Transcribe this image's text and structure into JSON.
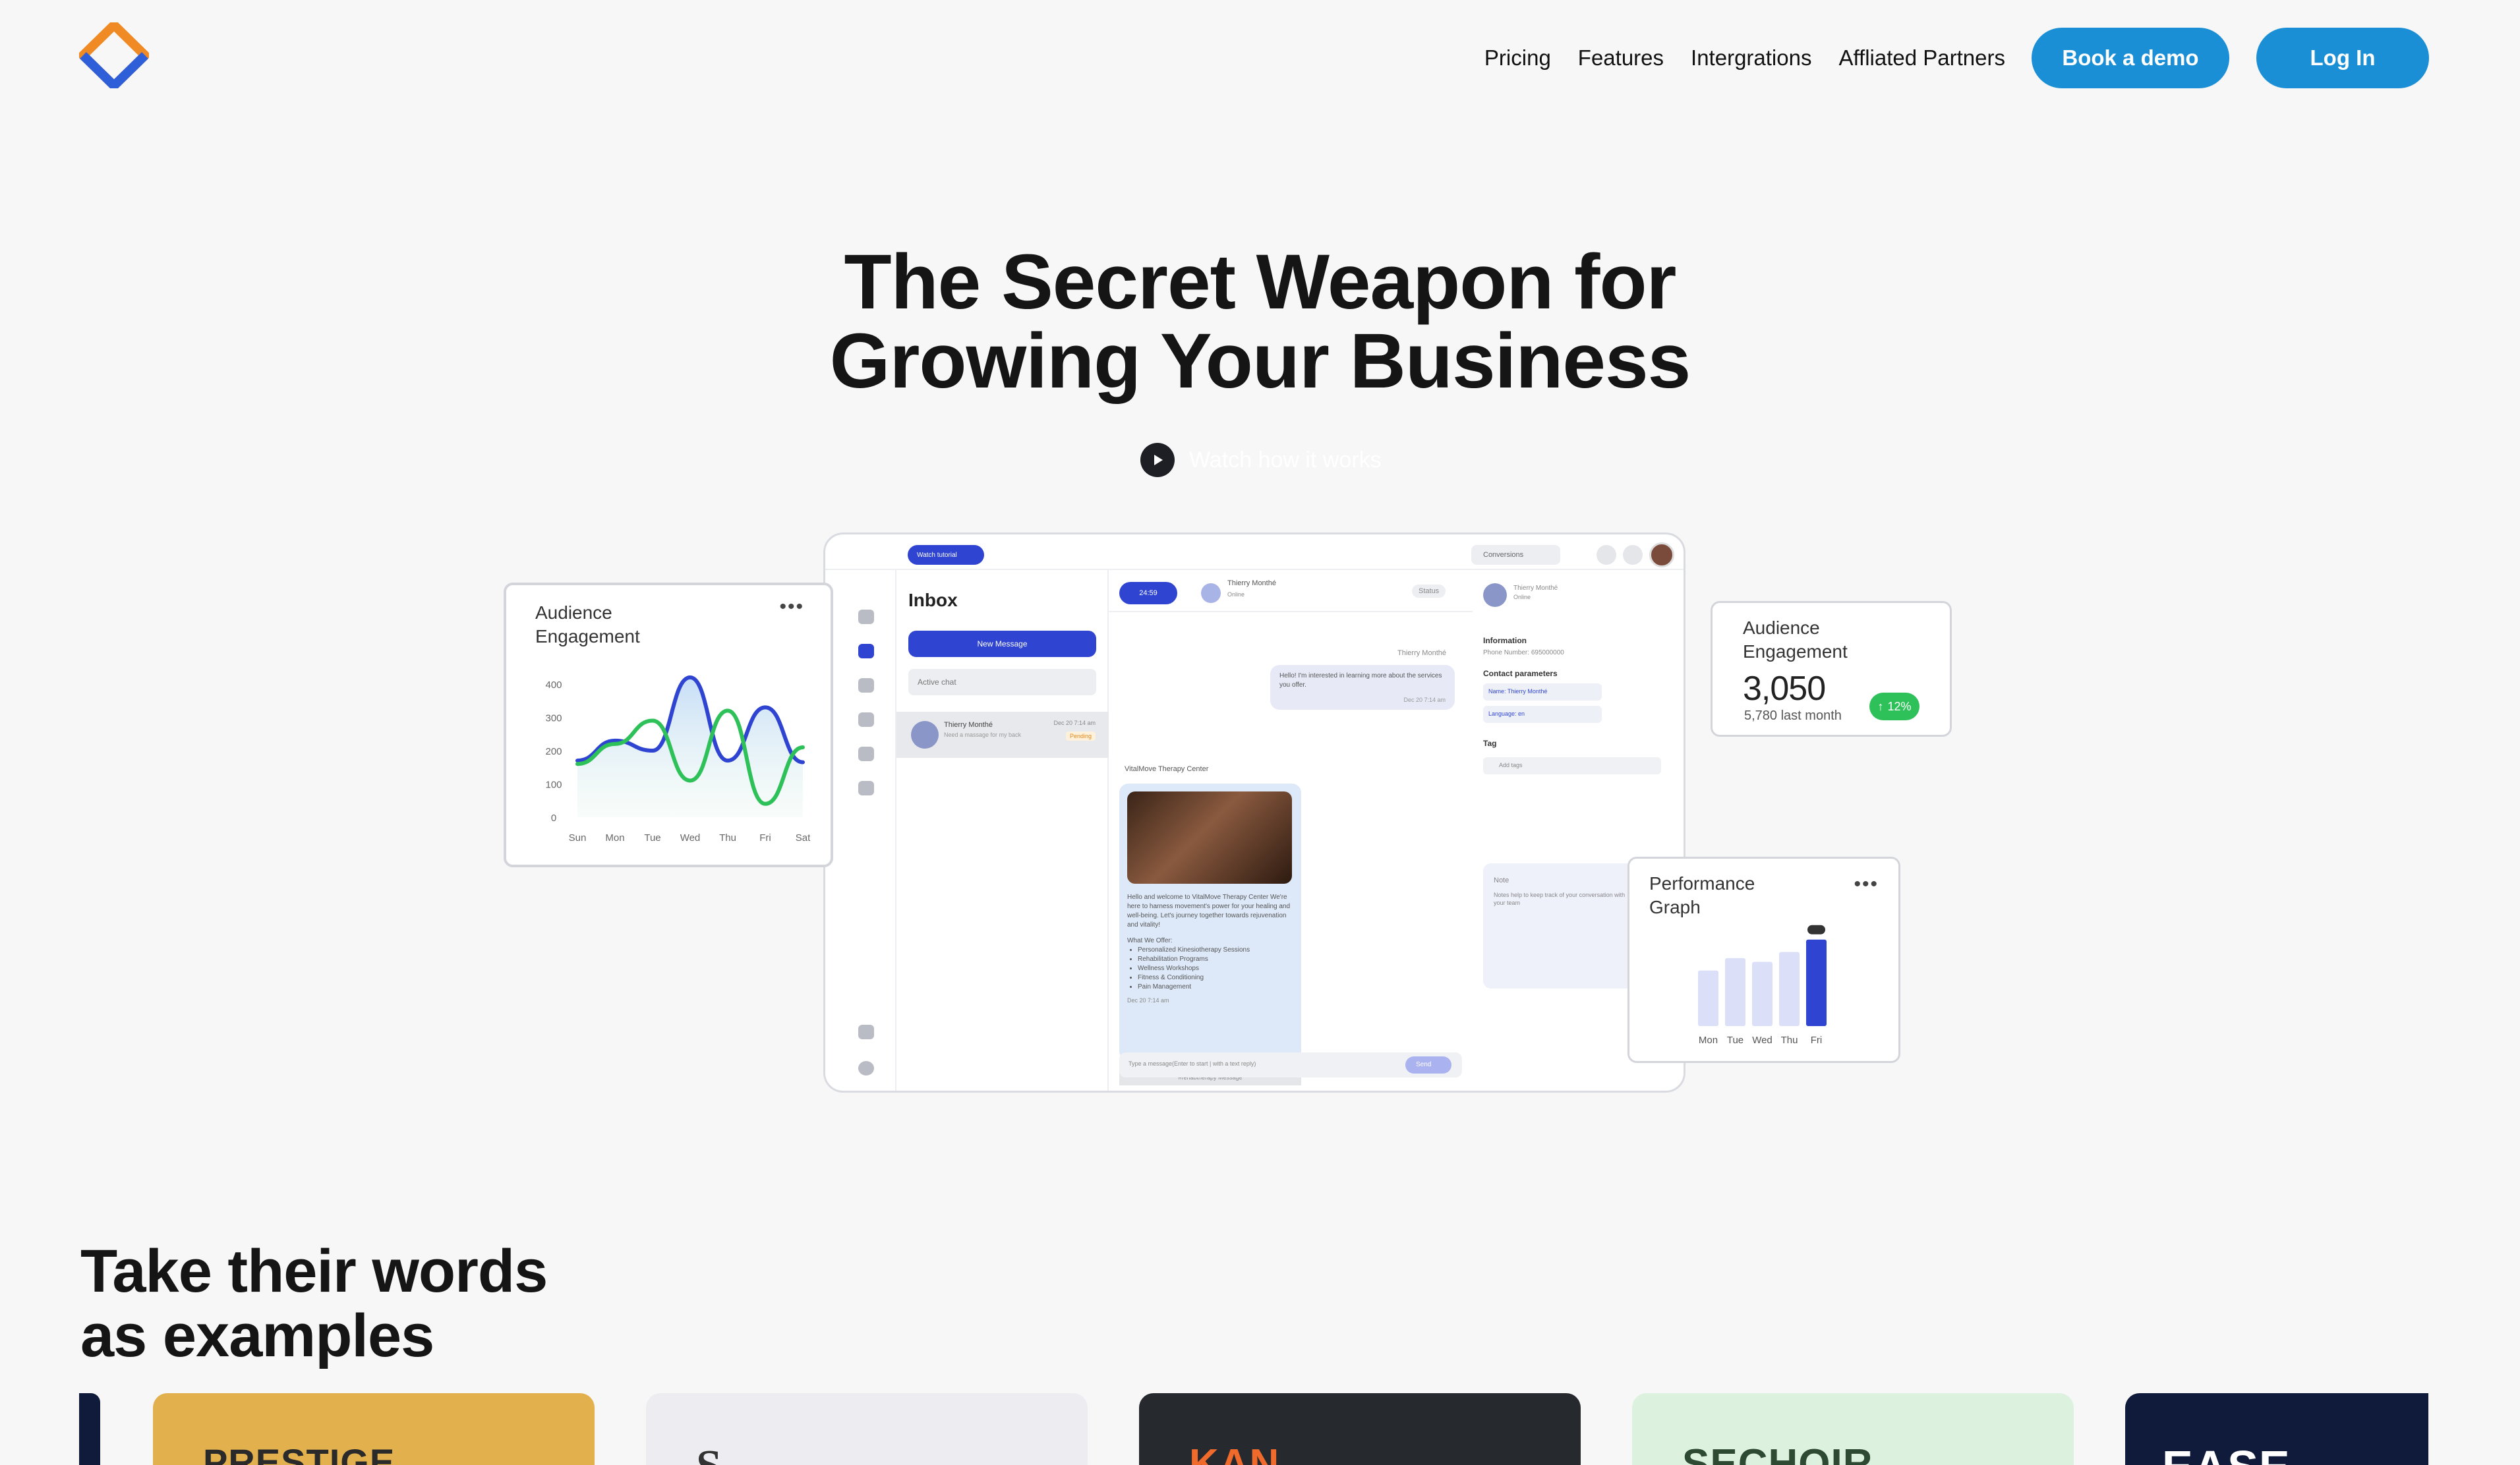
{
  "nav": {
    "links": [
      "Pricing",
      "Features",
      "Intergrations",
      "Affliated Partners"
    ],
    "demo_label": "Book a demo",
    "login_label": "Log In"
  },
  "colors": {
    "accent": "#1b8fd6",
    "brand_orange": "#f08a24",
    "brand_blue": "#2f5fd8",
    "app_blue": "#2f45d1",
    "success": "#2fc159"
  },
  "hero": {
    "title_line1": "The Secret Weapon for",
    "title_line2": "Growing Your Business",
    "watch_label": "Watch how it works",
    "play_icon": "play-icon"
  },
  "app": {
    "tutorial_label": "Watch tutorial",
    "conversions_label": "Conversions",
    "inbox_title": "Inbox",
    "new_message_label": "New Message",
    "active_chat_label": "Active chat",
    "chat_item": {
      "name": "Thierry Monthé",
      "preview": "Need a massage for my back",
      "date": "Dec 20 7:14 am",
      "status": "Pending"
    },
    "timer_label": "24:59",
    "contact_name": "Thierry Monthé",
    "contact_status": "Online",
    "status_dropdown": "Status",
    "incoming_message": "Hello! I'm interested in learning more about the services you offer.",
    "incoming_time": "Dec 20 7:14 am",
    "sender_name": "VitalMove Therapy Center",
    "outgoing_message": "Hello and welcome to VitalMove Therapy Center We're here to harness movement's power for your healing and well-being. Let's journey together towards rejuvenation and vitality!",
    "offer_heading": "What We Offer:",
    "offer_items": [
      "Personalized Kinesiotherapy Sessions",
      "Rehabilitation Programs",
      "Wellness Workshops",
      "Fitness & Conditioning",
      "Pain Management"
    ],
    "outgoing_time": "Dec 20 7:14 am",
    "template_label": "#rehabtherapy Message",
    "composer_placeholder": "Type a message(Enter to start | with a text reply)",
    "send_label": "Send",
    "info_heading": "Information",
    "phone_label": "Phone Number: 695000000",
    "contact_params_heading": "Contact parameters",
    "param_name": "Name: Thierry Monthé",
    "param_language": "Language: en",
    "tag_heading": "Tag",
    "tag_placeholder": "Add tags",
    "note_heading": "Note",
    "note_placeholder": "Notes help to keep track of your conversation with your team"
  },
  "audience_chart": {
    "title_line1": "Audience",
    "title_line2": "Engagement",
    "menu_icon": "more-icon"
  },
  "chart_data": [
    {
      "type": "line",
      "title": "Audience Engagement",
      "categories": [
        "Sun",
        "Mon",
        "Tue",
        "Wed",
        "Thu",
        "Fri",
        "Sat"
      ],
      "ylim": [
        0,
        400
      ],
      "yticks": [
        "400",
        "300",
        "200",
        "100",
        "0"
      ],
      "series": [
        {
          "values": [
            170,
            230,
            200,
            420,
            170,
            330,
            165
          ],
          "color": "#2f45d1"
        },
        {
          "values": [
            160,
            220,
            290,
            110,
            320,
            40,
            210
          ],
          "color": "#2fc159"
        }
      ]
    },
    {
      "type": "bar",
      "title": "Performance Graph",
      "categories": [
        "Mon",
        "Tue",
        "Wed",
        "Thu",
        "Fri"
      ],
      "values": [
        45,
        55,
        52,
        60,
        70
      ],
      "highlight_index": 4,
      "ylim": [
        0,
        80
      ],
      "grid": false
    }
  ],
  "audience_stat": {
    "title_line1": "Audience",
    "title_line2": "Engagement",
    "value": "3,050",
    "sub": "5,780 last month",
    "badge": "12%",
    "badge_icon": "arrow-up-icon"
  },
  "performance": {
    "title_line1": "Performance",
    "title_line2": "Graph",
    "menu_icon": "more-icon"
  },
  "testimonials": {
    "title_line1": "Take their words",
    "title_line2": "as examples",
    "logos": [
      {
        "name": "PRESTIGE",
        "bg": "#e3b04e",
        "fg": "#2a2a2a"
      },
      {
        "name": "S",
        "bg": "#ededf1",
        "fg": "#333333"
      },
      {
        "name": "KAN",
        "bg": "#26292e",
        "fg": "#f06a2c"
      },
      {
        "name": "SECHOIR",
        "bg": "#dcf2df",
        "fg": "#2f4a33"
      },
      {
        "name": "EASE",
        "bg": "#101a3a",
        "fg": "#ffffff"
      }
    ]
  }
}
